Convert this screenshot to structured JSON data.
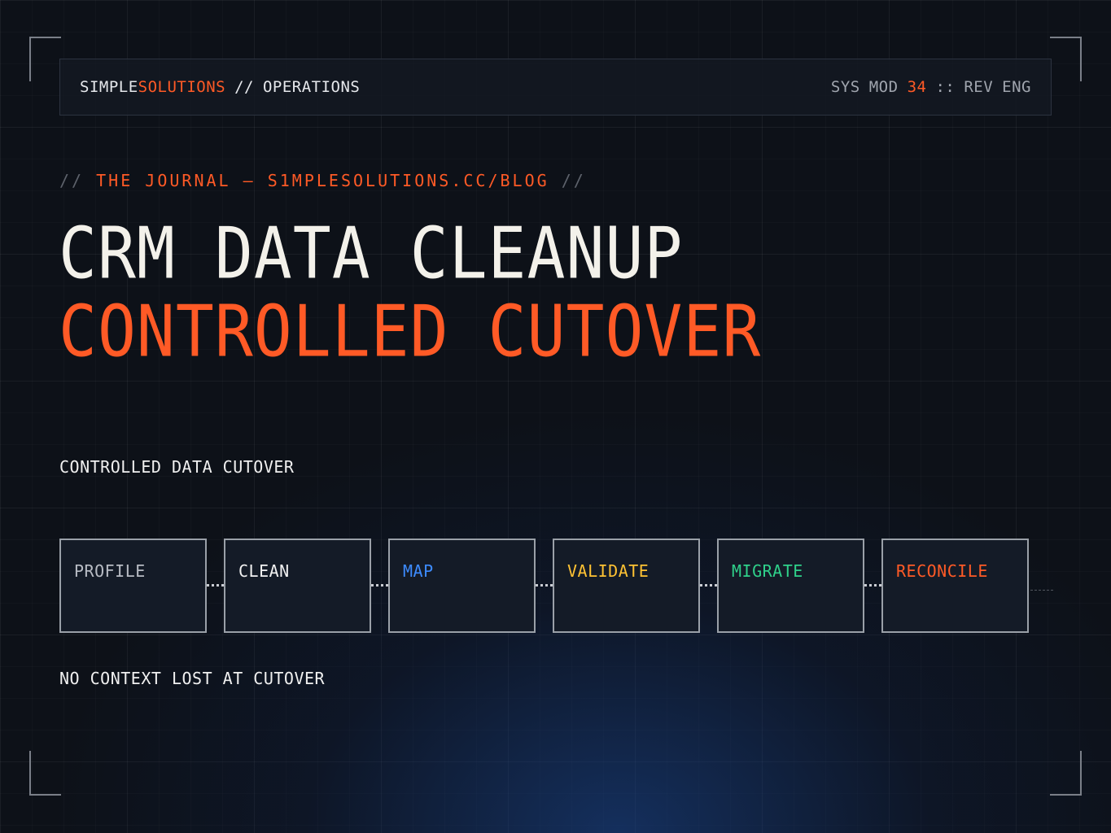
{
  "header": {
    "brand_primary": "SIMPLE",
    "brand_accent": "SOLUTIONS",
    "separator": "//",
    "section": "OPERATIONS",
    "sys_label": "SYS",
    "mod_label": "MOD",
    "mod_number": "34",
    "delimiter": "::",
    "rev_label": "REV",
    "eng_label": "ENG"
  },
  "kicker": {
    "prefix": "//",
    "text": "THE JOURNAL — S1MPLESOLUTIONS.CC/BLOG",
    "suffix": "//"
  },
  "title": {
    "line1": "CRM DATA CLEANUP",
    "line2": "CONTROLLED CUTOVER"
  },
  "section_label": "CONTROLLED DATA CUTOVER",
  "pipeline": {
    "stages": [
      {
        "label": "PROFILE",
        "color": "#b8bcc4"
      },
      {
        "label": "CLEAN",
        "color": "#f2f2f2"
      },
      {
        "label": "MAP",
        "color": "#3d8bff"
      },
      {
        "label": "VALIDATE",
        "color": "#ffc233"
      },
      {
        "label": "MIGRATE",
        "color": "#2fd08a"
      },
      {
        "label": "RECONCILE",
        "color": "#ff5a26"
      }
    ]
  },
  "footer_label": "NO CONTEXT LOST AT CUTOVER",
  "colors": {
    "accent": "#ff5a26",
    "background": "#0d1118"
  }
}
